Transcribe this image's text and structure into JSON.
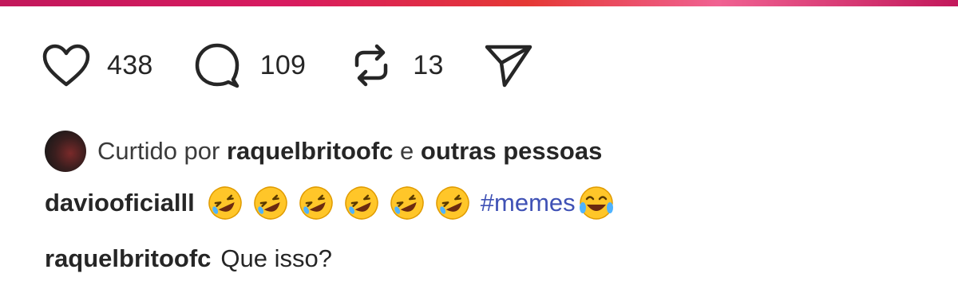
{
  "actions": {
    "likes": "438",
    "comments": "109",
    "reposts": "13"
  },
  "liked_by": {
    "prefix": "Curtido por",
    "user": "raquelbritoofc",
    "joiner": "e",
    "others": "outras pessoas"
  },
  "caption": {
    "user": "daviooficialll",
    "emojis": [
      "rofl-emoji",
      "rofl-emoji",
      "rofl-emoji",
      "rofl-emoji",
      "rofl-emoji",
      "rofl-emoji"
    ],
    "hashtag": "#memes",
    "trailing_emoji": "joy-emoji"
  },
  "comment": {
    "user": "raquelbritoofc",
    "text": "Que isso?"
  },
  "colors": {
    "accent_bar": "#d81b60",
    "hashtag": "#3f51b5",
    "text": "#262626"
  }
}
